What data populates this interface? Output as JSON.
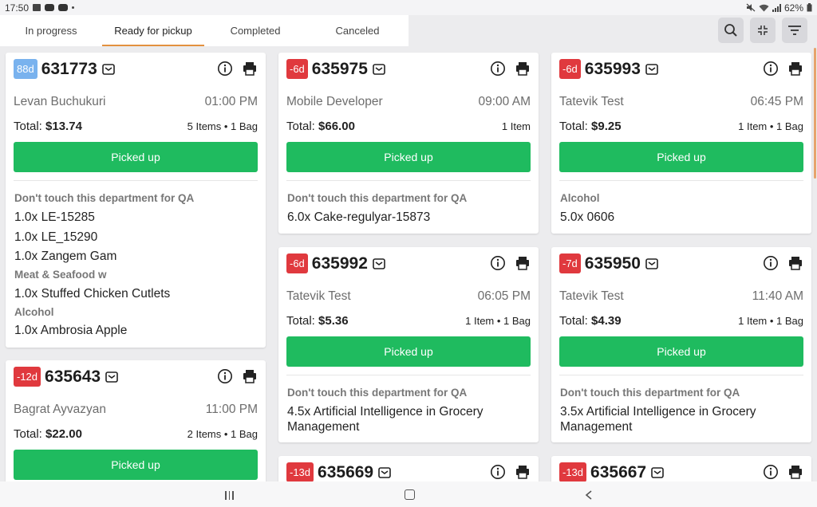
{
  "status_bar": {
    "time": "17:50",
    "battery": "62%"
  },
  "tabs": [
    {
      "label": "In progress"
    },
    {
      "label": "Ready for pickup",
      "active": true
    },
    {
      "label": "Completed"
    },
    {
      "label": "Canceled"
    }
  ],
  "toolbar": {
    "search_icon": "search-icon",
    "collapse_icon": "collapse-icon",
    "filter_icon": "filter-icon"
  },
  "colors": {
    "accent_tab": "#e3913f",
    "button_green": "#1fbb5f",
    "badge_red": "#e0393e",
    "badge_blue": "#79b2ee"
  },
  "pickup_label": "Picked up",
  "orders": [
    {
      "badge": "88d",
      "badge_color": "blue",
      "number": "631773",
      "customer": "Levan Buchukuri",
      "time": "01:00 PM",
      "total_label": "Total: ",
      "total": "$13.74",
      "items": "5 Items • 1 Bag",
      "groups": [
        {
          "dept": "Don't touch this department for QA",
          "lines": [
            "1.0x LE-15285",
            "1.0x LE_15290",
            "1.0x Zangem Gam"
          ]
        },
        {
          "dept": "Meat & Seafood w",
          "lines": [
            "1.0x Stuffed Chicken Cutlets"
          ]
        },
        {
          "dept": "Alcohol",
          "lines": [
            "1.0x Ambrosia Apple"
          ]
        }
      ]
    },
    {
      "badge": "-6d",
      "badge_color": "red",
      "number": "635975",
      "customer": "Mobile Developer",
      "time": "09:00 AM",
      "total_label": "Total: ",
      "total": "$66.00",
      "items": "1 Item",
      "groups": [
        {
          "dept": "Don't touch this department for QA",
          "lines": [
            "6.0x Cake-regulyar-15873"
          ]
        }
      ]
    },
    {
      "badge": "-6d",
      "badge_color": "red",
      "number": "635993",
      "customer": "Tatevik Test",
      "time": "06:45 PM",
      "total_label": "Total: ",
      "total": "$9.25",
      "items": "1 Item • 1 Bag",
      "groups": [
        {
          "dept": "Alcohol",
          "lines": [
            "5.0x 0606"
          ]
        }
      ]
    },
    {
      "badge": "-12d",
      "badge_color": "red",
      "number": "635643",
      "customer": "Bagrat Ayvazyan",
      "time": "11:00 PM",
      "total_label": "Total: ",
      "total": "$22.00",
      "items": "2 Items • 1 Bag",
      "groups": []
    },
    {
      "badge": "-6d",
      "badge_color": "red",
      "number": "635992",
      "customer": "Tatevik Test",
      "time": "06:05 PM",
      "total_label": "Total: ",
      "total": "$5.36",
      "items": "1 Item • 1 Bag",
      "groups": [
        {
          "dept": "Don't touch this department for QA",
          "lines": [
            "4.5x Artificial Intelligence in Grocery",
            "Management"
          ]
        }
      ]
    },
    {
      "badge": "-7d",
      "badge_color": "red",
      "number": "635950",
      "customer": "Tatevik Test",
      "time": "11:40 AM",
      "total_label": "Total: ",
      "total": "$4.39",
      "items": "1 Item • 1 Bag",
      "groups": [
        {
          "dept": "Don't touch this department for QA",
          "lines": [
            "3.5x Artificial Intelligence in Grocery",
            "Management"
          ]
        }
      ]
    },
    {
      "badge": "-13d",
      "badge_color": "red",
      "number": "635669",
      "customer": "",
      "time": "",
      "total_label": "",
      "total": "",
      "items": "",
      "groups": []
    },
    {
      "badge": "-13d",
      "badge_color": "red",
      "number": "635667",
      "customer": "",
      "time": "",
      "total_label": "",
      "total": "",
      "items": "",
      "groups": []
    }
  ]
}
